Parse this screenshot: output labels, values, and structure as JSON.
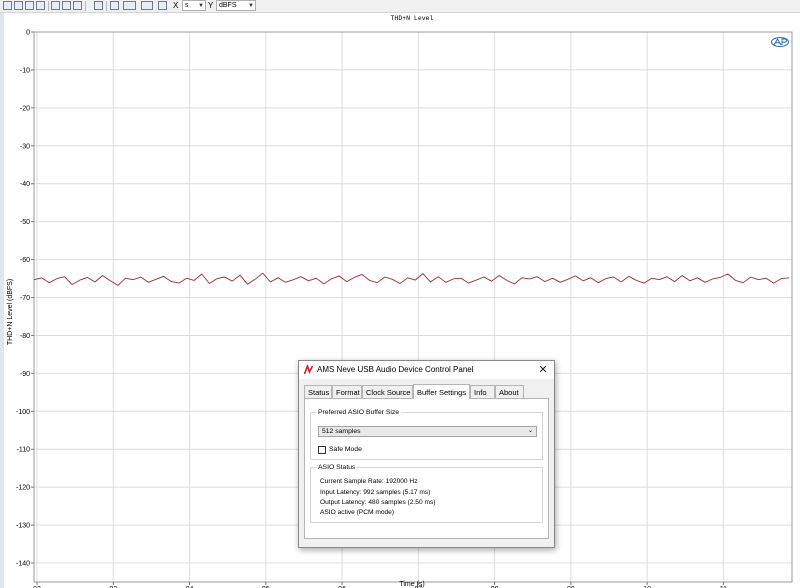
{
  "toolbar": {
    "x_label": "X",
    "x_unit": "s",
    "y_label": "Y",
    "y_unit": "dBFS",
    "icons": [
      "save-icon",
      "open-icon",
      "print-icon",
      "zoom-in-icon",
      "zoom-fit-icon",
      "crosshair-icon",
      "table-icon",
      "legend-icon",
      "autoscale-icon",
      "cursor-icon"
    ]
  },
  "chart_data": {
    "type": "line",
    "title": "THD+N Level",
    "xlabel": "Time (s)",
    "ylabel": "THD+N Level (dBFS)",
    "xlim": [
      1.96,
      11.9
    ],
    "ylim": [
      -145,
      0
    ],
    "x_ticks": [
      2,
      3,
      4,
      5,
      6,
      7,
      8,
      9,
      10,
      11
    ],
    "x_tick_labels": [
      "02",
      "03",
      "04",
      "05",
      "06",
      "07",
      "08",
      "09",
      "10",
      "11"
    ],
    "y_ticks": [
      0,
      -10,
      -20,
      -30,
      -40,
      -50,
      -60,
      -70,
      -80,
      -90,
      -100,
      -110,
      -120,
      -130,
      -140
    ],
    "grid": true,
    "line_color": "#9e2a3c",
    "series": [
      {
        "x": [
          1.96,
          2.06,
          2.16,
          2.26,
          2.36,
          2.46,
          2.56,
          2.66,
          2.76,
          2.86,
          2.96,
          3.06,
          3.16,
          3.26,
          3.36,
          3.46,
          3.56,
          3.66,
          3.76,
          3.86,
          3.96,
          4.06,
          4.16,
          4.26,
          4.36,
          4.46,
          4.56,
          4.66,
          4.76,
          4.86,
          4.96,
          5.06,
          5.16,
          5.26,
          5.36,
          5.46,
          5.56,
          5.66,
          5.76,
          5.86,
          5.96,
          6.06,
          6.16,
          6.26,
          6.36,
          6.46,
          6.56,
          6.66,
          6.76,
          6.86,
          6.96,
          7.06,
          7.16,
          7.26,
          7.36,
          7.46,
          7.56,
          7.66,
          7.76,
          7.86,
          7.96,
          8.06,
          8.16,
          8.26,
          8.36,
          8.46,
          8.56,
          8.66,
          8.76,
          8.86,
          8.96,
          9.06,
          9.16,
          9.26,
          9.36,
          9.46,
          9.56,
          9.66,
          9.76,
          9.86,
          9.96,
          10.06,
          10.16,
          10.26,
          10.36,
          10.46,
          10.56,
          10.66,
          10.76,
          10.86,
          10.96,
          11.06,
          11.16,
          11.26,
          11.36,
          11.46,
          11.56,
          11.66,
          11.76,
          11.86
        ],
        "y": [
          -65.3,
          -64.8,
          -66.1,
          -65.0,
          -64.5,
          -66.6,
          -65.4,
          -64.7,
          -65.9,
          -64.2,
          -65.6,
          -66.8,
          -64.9,
          -65.3,
          -64.6,
          -66.0,
          -65.2,
          -64.4,
          -65.8,
          -66.2,
          -64.9,
          -65.5,
          -63.8,
          -66.3,
          -65.0,
          -64.6,
          -65.7,
          -64.1,
          -66.5,
          -65.2,
          -63.6,
          -65.9,
          -64.8,
          -66.0,
          -65.3,
          -64.5,
          -65.6,
          -64.9,
          -66.4,
          -65.1,
          -64.3,
          -65.8,
          -64.7,
          -63.9,
          -65.5,
          -66.1,
          -64.6,
          -65.2,
          -66.3,
          -64.8,
          -65.4,
          -63.7,
          -65.9,
          -64.5,
          -66.0,
          -65.1,
          -64.9,
          -66.2,
          -65.4,
          -64.6,
          -65.7,
          -64.2,
          -65.5,
          -66.4,
          -64.8,
          -65.1,
          -64.5,
          -65.8,
          -64.9,
          -66.0,
          -65.2,
          -64.3,
          -65.6,
          -64.8,
          -66.1,
          -65.0,
          -64.6,
          -65.9,
          -64.4,
          -65.5,
          -66.2,
          -64.9,
          -65.3,
          -64.5,
          -65.8,
          -64.2,
          -65.6,
          -64.8,
          -66.0,
          -65.1,
          -64.7,
          -63.8,
          -65.5,
          -66.1,
          -64.6,
          -65.3,
          -64.9,
          -66.2,
          -65.0,
          -64.8
        ]
      }
    ]
  },
  "dialog": {
    "title": "AMS Neve USB Audio Device Control Panel",
    "close_glyph": "✕",
    "tabs": [
      "Status",
      "Format",
      "Clock Source",
      "Buffer Settings",
      "Info",
      "About"
    ],
    "active_tab": "Buffer Settings",
    "buffer_group_label": "Preferred ASIO Buffer Size",
    "buffer_value": "512 samples",
    "safe_mode_label": "Safe Mode",
    "status_group_label": "ASIO Status",
    "status_lines": [
      "Current Sample Rate: 192000 Hz",
      "Input Latency: 992 samples (5.17 ms)",
      "Output Latency: 480 samples (2.50 ms)",
      "ASIO active (PCM mode)"
    ]
  }
}
